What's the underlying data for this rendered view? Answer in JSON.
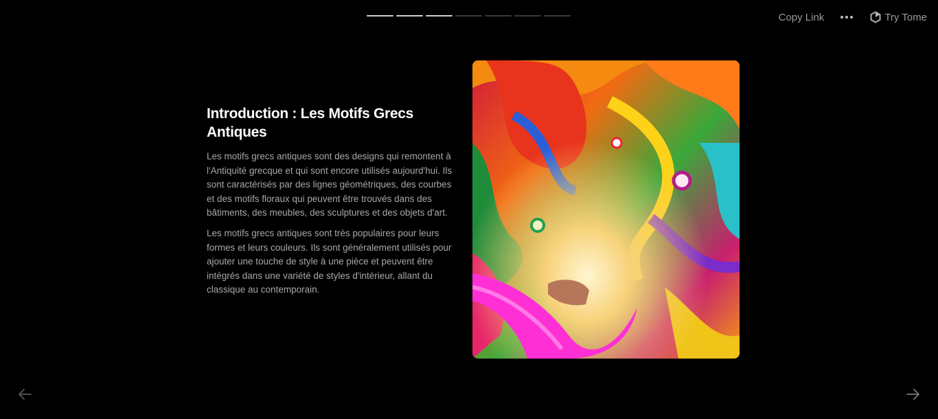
{
  "progress": {
    "total": 7,
    "current": 3
  },
  "topbar": {
    "copy_link": "Copy Link",
    "try_label": "Try Tome"
  },
  "slide": {
    "title": "Introduction : Les Motifs Grecs Antiques",
    "paragraphs": [
      "Les motifs grecs antiques sont des designs qui remontent à l'Antiquité grecque et qui sont encore utilisés aujourd'hui. Ils sont caractérisés par des lignes géométriques, des courbes et des motifs floraux qui peuvent être trouvés dans des bâtiments, des meubles, des sculptures et des objets d'art.",
      "Les motifs grecs antiques sont très populaires pour leurs formes et leurs couleurs. Ils sont généralement utilisés pour ajouter une touche de style à une pièce et peuvent être intégrés dans une variété de styles d'intérieur, allant du classique au contemporain."
    ]
  },
  "icons": {
    "more": "more-dots-icon",
    "try": "tome-logo-icon",
    "prev": "arrow-left-icon",
    "next": "arrow-right-icon"
  },
  "colors": {
    "background": "#000000",
    "title": "#ffffff",
    "body_text": "#a8a8a8",
    "muted": "#9a9a9a"
  }
}
